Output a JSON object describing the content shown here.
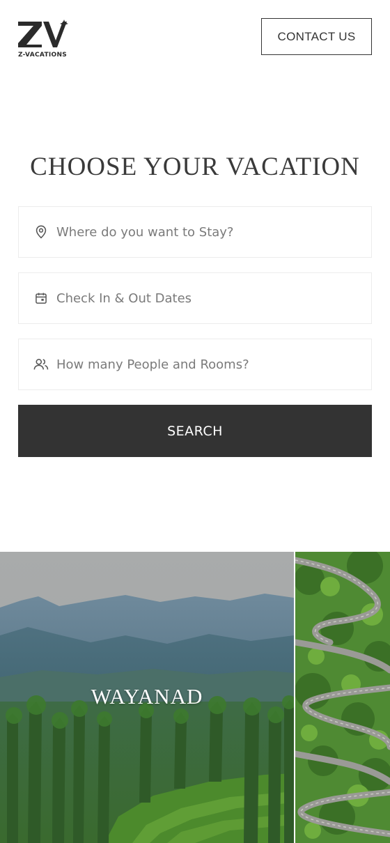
{
  "brand": {
    "logo_icon": "z-vacations-logo-icon",
    "name": "Z-VACATIONS"
  },
  "header": {
    "contact_label": "CONTACT US"
  },
  "main": {
    "title": "CHOOSE YOUR VACATION",
    "fields": {
      "location": {
        "icon": "location-pin-icon",
        "placeholder": "Where do you want to Stay?"
      },
      "dates": {
        "icon": "calendar-icon",
        "placeholder": "Check In & Out Dates"
      },
      "guests": {
        "icon": "people-icon",
        "placeholder": "How many People and Rooms?"
      }
    },
    "search_label": "SEARCH"
  },
  "destinations": [
    {
      "name": "WAYANAD"
    }
  ],
  "colors": {
    "primary_dark": "#333333",
    "field_border": "#ececec",
    "placeholder": "#7a7a7a"
  }
}
